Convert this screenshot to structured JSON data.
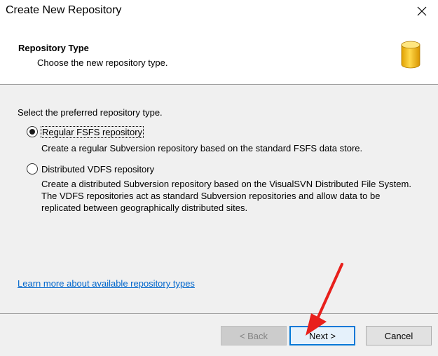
{
  "window": {
    "title": "Create New Repository"
  },
  "header": {
    "title": "Repository Type",
    "subtitle": "Choose the new repository type."
  },
  "content": {
    "intro": "Select the preferred repository type.",
    "options": [
      {
        "label": "Regular FSFS repository",
        "selected": true,
        "description": "Create a regular Subversion repository based on the standard FSFS data store."
      },
      {
        "label": "Distributed VDFS repository",
        "selected": false,
        "description": "Create a distributed Subversion repository based on the VisualSVN Distributed File System. The VDFS repositories act as standard Subversion repositories and allow data to be replicated between geographically distributed sites."
      }
    ],
    "learn_more_link": "Learn more about available repository types"
  },
  "footer": {
    "back_label": "< Back",
    "next_label": "Next >",
    "cancel_label": "Cancel"
  },
  "colors": {
    "link": "#0066cc",
    "annotation_arrow": "#e8201c",
    "default_button_border": "#0078d7",
    "db_icon": "#f2b705"
  },
  "icons": {
    "close": "close-icon",
    "header": "database-icon",
    "annotation": "red-arrow-icon"
  }
}
